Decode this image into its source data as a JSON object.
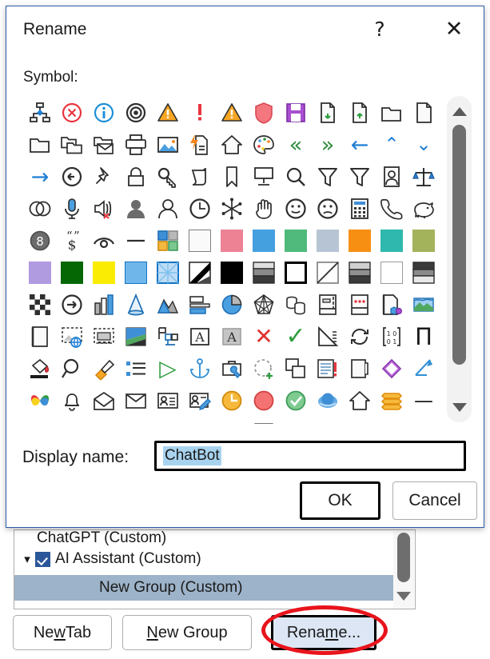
{
  "owner_window": {
    "list": {
      "clipped_row_label": "ChatGPT (Custom)",
      "rows": [
        {
          "label": "AI Assistant (Custom)",
          "checked": true,
          "expanded": true
        },
        {
          "label": "New Group (Custom)",
          "selected": true
        }
      ]
    },
    "buttons": {
      "new_tab": {
        "pre": "Ne",
        "accel": "w",
        "post": " Tab"
      },
      "new_group": {
        "pre": "",
        "accel": "N",
        "post": "ew Group"
      },
      "rename": {
        "pre": "Rena",
        "accel": "m",
        "post": "e..."
      }
    },
    "annotation": {
      "shape": "ellipse",
      "color": "#e8141c",
      "target": "rename-button"
    }
  },
  "dialog": {
    "title": "Rename",
    "help_icon": "?",
    "close_icon": "✕",
    "symbol_label": "Symbol:",
    "display_name_label": "Display name:",
    "display_name_value": "ChatBot",
    "display_name_selected": true,
    "ok_label": "OK",
    "cancel_label": "Cancel",
    "focused_control": "ok-button"
  },
  "colors": {
    "dialog_border": "#2d5ba8",
    "selection_blue": "#a8d3ef",
    "list_selection": "#9db3c9",
    "checkbox_blue": "#2b579a",
    "rename_highlight": "#dce6f4",
    "annotation_red": "#e8141c",
    "scrollbar_thumb": "#6e6e6e"
  },
  "symbol_grid": {
    "columns": 13,
    "rows": 11,
    "scroll_position": "near-top",
    "symbols": [
      {
        "name": "org-chart-icon",
        "kind": "svg",
        "id": "orgchart"
      },
      {
        "name": "cancel-circle-icon",
        "kind": "svg",
        "id": "cancelx"
      },
      {
        "name": "info-circle-icon",
        "kind": "svg",
        "id": "info"
      },
      {
        "name": "target-icon",
        "kind": "svg",
        "id": "target"
      },
      {
        "name": "warning-triangle-icon",
        "kind": "svg",
        "id": "warn"
      },
      {
        "name": "exclamation-icon",
        "kind": "svg",
        "id": "excl"
      },
      {
        "name": "warning-triangle-icon",
        "kind": "svg",
        "id": "warn"
      },
      {
        "name": "shield-icon",
        "kind": "svg",
        "id": "shield"
      },
      {
        "name": "save-disk-icon",
        "kind": "svg",
        "id": "save"
      },
      {
        "name": "document-down-icon",
        "kind": "svg",
        "id": "docdown"
      },
      {
        "name": "document-up-icon",
        "kind": "svg",
        "id": "docup"
      },
      {
        "name": "folder-open-icon",
        "kind": "svg",
        "id": "folderopen"
      },
      {
        "name": "page-icon",
        "kind": "svg",
        "id": "page"
      },
      {
        "name": "folder-icon",
        "kind": "svg",
        "id": "folder"
      },
      {
        "name": "copy-folder-icon",
        "kind": "svg",
        "id": "folder2"
      },
      {
        "name": "folder-mail-icon",
        "kind": "svg",
        "id": "foldermail"
      },
      {
        "name": "printer-icon",
        "kind": "svg",
        "id": "printer"
      },
      {
        "name": "picture-icon",
        "kind": "svg",
        "id": "picture"
      },
      {
        "name": "quick-document-icon",
        "kind": "svg",
        "id": "quickdoc"
      },
      {
        "name": "home-icon",
        "kind": "svg",
        "id": "home"
      },
      {
        "name": "palette-icon",
        "kind": "svg",
        "id": "palette"
      },
      {
        "name": "double-arrow-left-icon",
        "kind": "glyph",
        "char": "«",
        "color": "#2e8b3d",
        "size": 27
      },
      {
        "name": "double-arrow-right-icon",
        "kind": "glyph",
        "char": "»",
        "color": "#2e8b3d",
        "size": 27
      },
      {
        "name": "arrow-left-icon",
        "kind": "glyph",
        "char": "←",
        "color": "#1e7fd4",
        "size": 27
      },
      {
        "name": "chevron-up-icon",
        "kind": "glyph",
        "char": "⌃",
        "color": "#1e7fd4",
        "size": 23
      },
      {
        "name": "chevron-down-icon",
        "kind": "glyph",
        "char": "⌄",
        "color": "#1e7fd4",
        "size": 23
      },
      {
        "name": "arrow-right-icon",
        "kind": "glyph",
        "char": "→",
        "color": "#1e7fd4",
        "size": 27
      },
      {
        "name": "back-circle-icon",
        "kind": "svg",
        "id": "backcircle"
      },
      {
        "name": "pushpin-icon",
        "kind": "svg",
        "id": "pin"
      },
      {
        "name": "lock-icon",
        "kind": "svg",
        "id": "lock"
      },
      {
        "name": "key-icon",
        "kind": "svg",
        "id": "key"
      },
      {
        "name": "scroll-icon",
        "kind": "svg",
        "id": "scroll"
      },
      {
        "name": "bookmark-icon",
        "kind": "svg",
        "id": "bookmark"
      },
      {
        "name": "projector-icon",
        "kind": "svg",
        "id": "projector"
      },
      {
        "name": "search-icon",
        "kind": "svg",
        "id": "search"
      },
      {
        "name": "filter-icon",
        "kind": "svg",
        "id": "filter"
      },
      {
        "name": "filter-icon",
        "kind": "svg",
        "id": "filter"
      },
      {
        "name": "contact-card-icon",
        "kind": "svg",
        "id": "contact"
      },
      {
        "name": "balance-scale-icon",
        "kind": "svg",
        "id": "scale"
      },
      {
        "name": "venn-icon",
        "kind": "svg",
        "id": "venn"
      },
      {
        "name": "microphone-icon",
        "kind": "svg",
        "id": "mic"
      },
      {
        "name": "speaker-mute-icon",
        "kind": "svg",
        "id": "mute"
      },
      {
        "name": "person-filled-icon",
        "kind": "svg",
        "id": "personfill"
      },
      {
        "name": "person-outline-icon",
        "kind": "svg",
        "id": "person"
      },
      {
        "name": "clock-icon",
        "kind": "svg",
        "id": "clock"
      },
      {
        "name": "snowflake-icon",
        "kind": "svg",
        "id": "snow"
      },
      {
        "name": "hand-icon",
        "kind": "svg",
        "id": "hand"
      },
      {
        "name": "smiley-happy-icon",
        "kind": "svg",
        "id": "happy"
      },
      {
        "name": "smiley-sad-icon",
        "kind": "svg",
        "id": "sad"
      },
      {
        "name": "calculator-icon",
        "kind": "svg",
        "id": "calc"
      },
      {
        "name": "phone-icon",
        "kind": "svg",
        "id": "phone"
      },
      {
        "name": "piggy-bank-icon",
        "kind": "svg",
        "id": "piggy"
      },
      {
        "name": "eight-ball-icon",
        "kind": "svg",
        "id": "eightball"
      },
      {
        "name": "quote-dollar-icon",
        "kind": "svg",
        "id": "quotedollar"
      },
      {
        "name": "eye-icon",
        "kind": "svg",
        "id": "eye"
      },
      {
        "name": "dash-icon",
        "kind": "svg",
        "id": "dash"
      },
      {
        "name": "four-color-grid-icon",
        "kind": "svg",
        "id": "fourgrid"
      },
      {
        "name": "swatch-white",
        "kind": "swatch",
        "color": "#fafafa",
        "border": "#808080"
      },
      {
        "name": "swatch-pink",
        "kind": "swatch",
        "color": "#ed8295"
      },
      {
        "name": "swatch-blue",
        "kind": "swatch",
        "color": "#45a0e0"
      },
      {
        "name": "swatch-green",
        "kind": "swatch",
        "color": "#4fba7c"
      },
      {
        "name": "swatch-gray-blue",
        "kind": "swatch",
        "color": "#b7c4d4"
      },
      {
        "name": "swatch-orange",
        "kind": "swatch",
        "color": "#f78f13"
      },
      {
        "name": "swatch-teal",
        "kind": "swatch",
        "color": "#2fb8ad"
      },
      {
        "name": "swatch-olive",
        "kind": "swatch",
        "color": "#a3b35c"
      },
      {
        "name": "swatch-purple",
        "kind": "swatch",
        "color": "#b09ae0"
      },
      {
        "name": "swatch-dark-green",
        "kind": "swatch",
        "color": "#046704"
      },
      {
        "name": "swatch-yellow",
        "kind": "swatch",
        "color": "#fbec04"
      },
      {
        "name": "swatch-light-blue-border",
        "kind": "swatch",
        "color": "#6fb7ea",
        "border": "#1573c4"
      },
      {
        "name": "swatch-pattern-cross",
        "kind": "svg",
        "id": "patcross"
      },
      {
        "name": "swatch-diagonal-split",
        "kind": "svg",
        "id": "diagsplit"
      },
      {
        "name": "swatch-black",
        "kind": "swatch",
        "color": "#000000"
      },
      {
        "name": "swatch-gradient-gray",
        "kind": "svg",
        "id": "gradgray"
      },
      {
        "name": "swatch-white-thick",
        "kind": "swatch",
        "color": "#ffffff",
        "border": "#000000",
        "thick": true
      },
      {
        "name": "swatch-diagonal-line",
        "kind": "svg",
        "id": "diagline"
      },
      {
        "name": "swatch-gray-bands",
        "kind": "svg",
        "id": "graybands"
      },
      {
        "name": "swatch-plain-white",
        "kind": "swatch",
        "color": "#ffffff",
        "border": "#9a9a9a"
      },
      {
        "name": "swatch-dark-bands",
        "kind": "svg",
        "id": "darkbands"
      },
      {
        "name": "checkerboard-icon",
        "kind": "svg",
        "id": "checker"
      },
      {
        "name": "arrow-circle-right-icon",
        "kind": "svg",
        "id": "arrowcircle"
      },
      {
        "name": "bar-chart-icon",
        "kind": "svg",
        "id": "barchart"
      },
      {
        "name": "cone-icon",
        "kind": "svg",
        "id": "cone"
      },
      {
        "name": "area-chart-icon",
        "kind": "svg",
        "id": "areachart"
      },
      {
        "name": "bar-horizontal-icon",
        "kind": "svg",
        "id": "barhoriz"
      },
      {
        "name": "pie-chart-icon",
        "kind": "svg",
        "id": "pie"
      },
      {
        "name": "radar-chart-icon",
        "kind": "svg",
        "id": "radar"
      },
      {
        "name": "database-icon",
        "kind": "svg",
        "id": "database"
      },
      {
        "name": "notebook-icon",
        "kind": "svg",
        "id": "notebook"
      },
      {
        "name": "dots-card-icon",
        "kind": "svg",
        "id": "dotscard"
      },
      {
        "name": "page-objects-icon",
        "kind": "svg",
        "id": "pageobj"
      },
      {
        "name": "landscape-icon",
        "kind": "svg",
        "id": "landscape"
      },
      {
        "name": "page-blank-icon",
        "kind": "svg",
        "id": "pageblank"
      },
      {
        "name": "web-image-icon",
        "kind": "svg",
        "id": "webimg"
      },
      {
        "name": "film-strip-icon",
        "kind": "svg",
        "id": "film"
      },
      {
        "name": "color-gradient-icon",
        "kind": "svg",
        "id": "colorgrad"
      },
      {
        "name": "flag-chart-icon",
        "kind": "svg",
        "id": "flagchart"
      },
      {
        "name": "text-box-a-icon",
        "kind": "svg",
        "id": "boxa"
      },
      {
        "name": "text-box-a-gray-icon",
        "kind": "svg",
        "id": "boxagray"
      },
      {
        "name": "red-x-icon",
        "kind": "glyph",
        "char": "✕",
        "color": "#e03131",
        "size": 28
      },
      {
        "name": "green-check-icon",
        "kind": "glyph",
        "char": "✓",
        "color": "#2e9c3d",
        "size": 30
      },
      {
        "name": "ruler-icon",
        "kind": "svg",
        "id": "ruler"
      },
      {
        "name": "refresh-icon",
        "kind": "svg",
        "id": "refresh"
      },
      {
        "name": "binary-icon",
        "kind": "svg",
        "id": "binary"
      },
      {
        "name": "pi-icon",
        "kind": "glyph",
        "char": "Π",
        "color": "#1a1a1a",
        "size": 29
      },
      {
        "name": "paint-bucket-icon",
        "kind": "svg",
        "id": "bucket"
      },
      {
        "name": "magnifier-icon",
        "kind": "svg",
        "id": "magnify"
      },
      {
        "name": "brush-icon",
        "kind": "svg",
        "id": "brush"
      },
      {
        "name": "bullet-list-icon",
        "kind": "svg",
        "id": "bullets"
      },
      {
        "name": "play-icon",
        "kind": "glyph",
        "char": "▷",
        "color": "#2e9c3d",
        "size": 28
      },
      {
        "name": "anchor-icon",
        "kind": "svg",
        "id": "anchor"
      },
      {
        "name": "toolbox-icon",
        "kind": "svg",
        "id": "toolbox"
      },
      {
        "name": "add-selection-icon",
        "kind": "svg",
        "id": "addsel"
      },
      {
        "name": "copy-icon",
        "kind": "svg",
        "id": "copy"
      },
      {
        "name": "list-alert-icon",
        "kind": "svg",
        "id": "listalert"
      },
      {
        "name": "page-tab-icon",
        "kind": "svg",
        "id": "pagetab"
      },
      {
        "name": "eraser-icon",
        "kind": "svg",
        "id": "eraser"
      },
      {
        "name": "pen-path-icon",
        "kind": "svg",
        "id": "penpath"
      },
      {
        "name": "butterfly-icon",
        "kind": "svg",
        "id": "butterfly"
      },
      {
        "name": "bell-icon",
        "kind": "svg",
        "id": "bell"
      },
      {
        "name": "envelope-open-icon",
        "kind": "svg",
        "id": "envopen"
      },
      {
        "name": "envelope-icon",
        "kind": "svg",
        "id": "envelope"
      },
      {
        "name": "id-card-icon",
        "kind": "svg",
        "id": "idcard"
      },
      {
        "name": "edit-contact-icon",
        "kind": "svg",
        "id": "editcontact"
      },
      {
        "name": "clock-orange-icon",
        "kind": "svg",
        "id": "clockorange"
      },
      {
        "name": "red-circle-icon",
        "kind": "svg",
        "id": "redcircle"
      },
      {
        "name": "green-check-circle-icon",
        "kind": "svg",
        "id": "greencheck"
      },
      {
        "name": "internet-explorer-icon",
        "kind": "svg",
        "id": "ie"
      },
      {
        "name": "home-outline-icon",
        "kind": "svg",
        "id": "home2"
      },
      {
        "name": "orange-stack-icon",
        "kind": "svg",
        "id": "orangestack"
      },
      {
        "name": "minus-icon",
        "kind": "glyph",
        "char": "—",
        "color": "#1a1a1a",
        "size": 24
      },
      {
        "name": "partial-row-shape-icon",
        "kind": "svg",
        "id": "prow1"
      },
      {
        "name": "partial-row-page-icon",
        "kind": "svg",
        "id": "prow2"
      },
      {
        "name": "partial-row-star-icon",
        "kind": "svg",
        "id": "prow3"
      },
      {
        "name": "partial-row-parallelogram-icon",
        "kind": "svg",
        "id": "prow4"
      },
      {
        "name": "partial-row-line-icon",
        "kind": "svg",
        "id": "prow5"
      },
      {
        "name": "partial-row-blue-icon",
        "kind": "svg",
        "id": "prow6"
      },
      {
        "name": "partial-row-gray-icon",
        "kind": "svg",
        "id": "prow7"
      },
      {
        "name": "partial-row-bands-icon",
        "kind": "svg",
        "id": "prow8"
      },
      {
        "name": "partial-row-doc-icon",
        "kind": "svg",
        "id": "prow9"
      },
      {
        "name": "partial-row-table-icon",
        "kind": "svg",
        "id": "prow10"
      },
      {
        "name": "partial-row-arrow-icon",
        "kind": "svg",
        "id": "prow11"
      },
      {
        "name": "partial-row-box-icon",
        "kind": "svg",
        "id": "prow12"
      },
      {
        "name": "partial-row-end-icon",
        "kind": "svg",
        "id": "prow13"
      }
    ]
  }
}
